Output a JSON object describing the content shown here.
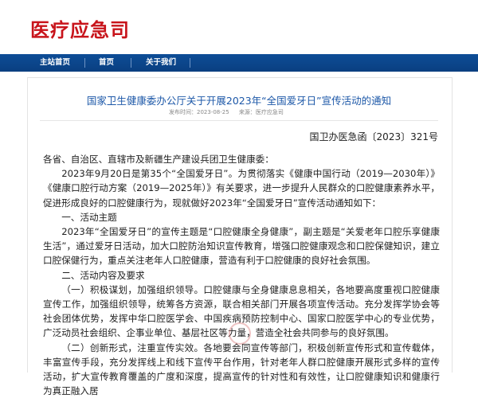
{
  "site": {
    "logo_text": "医疗应急司"
  },
  "nav": {
    "items": [
      {
        "label": "主站首页"
      },
      {
        "label": "首页"
      },
      {
        "label": "关于我们"
      }
    ]
  },
  "article": {
    "title": "国家卫生健康委办公厅关于开展2023年“全国爱牙日”宣传活动的通知",
    "published_label": "发布时间：",
    "published_date": "2023-08-25",
    "source_label": "来源：",
    "source": "医疗应急司",
    "doc_number": "国卫办医急函〔2023〕321号",
    "paragraphs": [
      "各省、自治区、直辖市及新疆生产建设兵团卫生健康委：",
      "2023年9月20日是第35个“全国爱牙日”。为贯彻落实《健康中国行动（2019—2030年）》《健康口腔行动方案（2019—2025年）》有关要求，进一步提升人民群众的口腔健康素养水平，促进形成良好的口腔健康行为，现就做好2023年“全国爱牙日”宣传活动通知如下：",
      "一、活动主题",
      "2023年“全国爱牙日”的宣传主题是“口腔健康全身健康”，副主题是“关爱老年口腔乐享健康生活”，通过爱牙日活动，加大口腔防治知识宣传教育，增强口腔健康观念和口腔保健知识，建立口腔保健行为，重点关注老年人口腔健康，营造有利于口腔健康的良好社会氛围。",
      "二、活动内容及要求",
      "（一）积极谋划，加强组织领导。口腔健康与全身健康息息相关，各地要高度重视口腔健康宣传工作，加强组织领导，统筹各方资源，联合相关部门开展各项宣传活动。充分发挥学协会等社会团体优势，发挥中华口腔医学会、中国疾病预防控制中心、国家口腔医学中心的专业优势，广泛动员社会组织、企事业单位、基层社区等力量，营造全社会共同参与的良好氛围。",
      "（二）创新形式，注重宣传实效。各地要会同宣传等部门，积极创新宣传形式和宣传载体，丰富宣传手段，充分发挥线上和线下宣传平台作用，针对老年人群口腔健康开展形式多样的宣传活动，扩大宣传教育覆盖的广度和深度，提高宣传的针对性和有效性，让口腔健康知识和健康行为真正融入居"
    ]
  },
  "colors": {
    "brand_red": "#c8141b",
    "nav_blue": "#0d4d97",
    "title_blue": "#1d58a8"
  }
}
